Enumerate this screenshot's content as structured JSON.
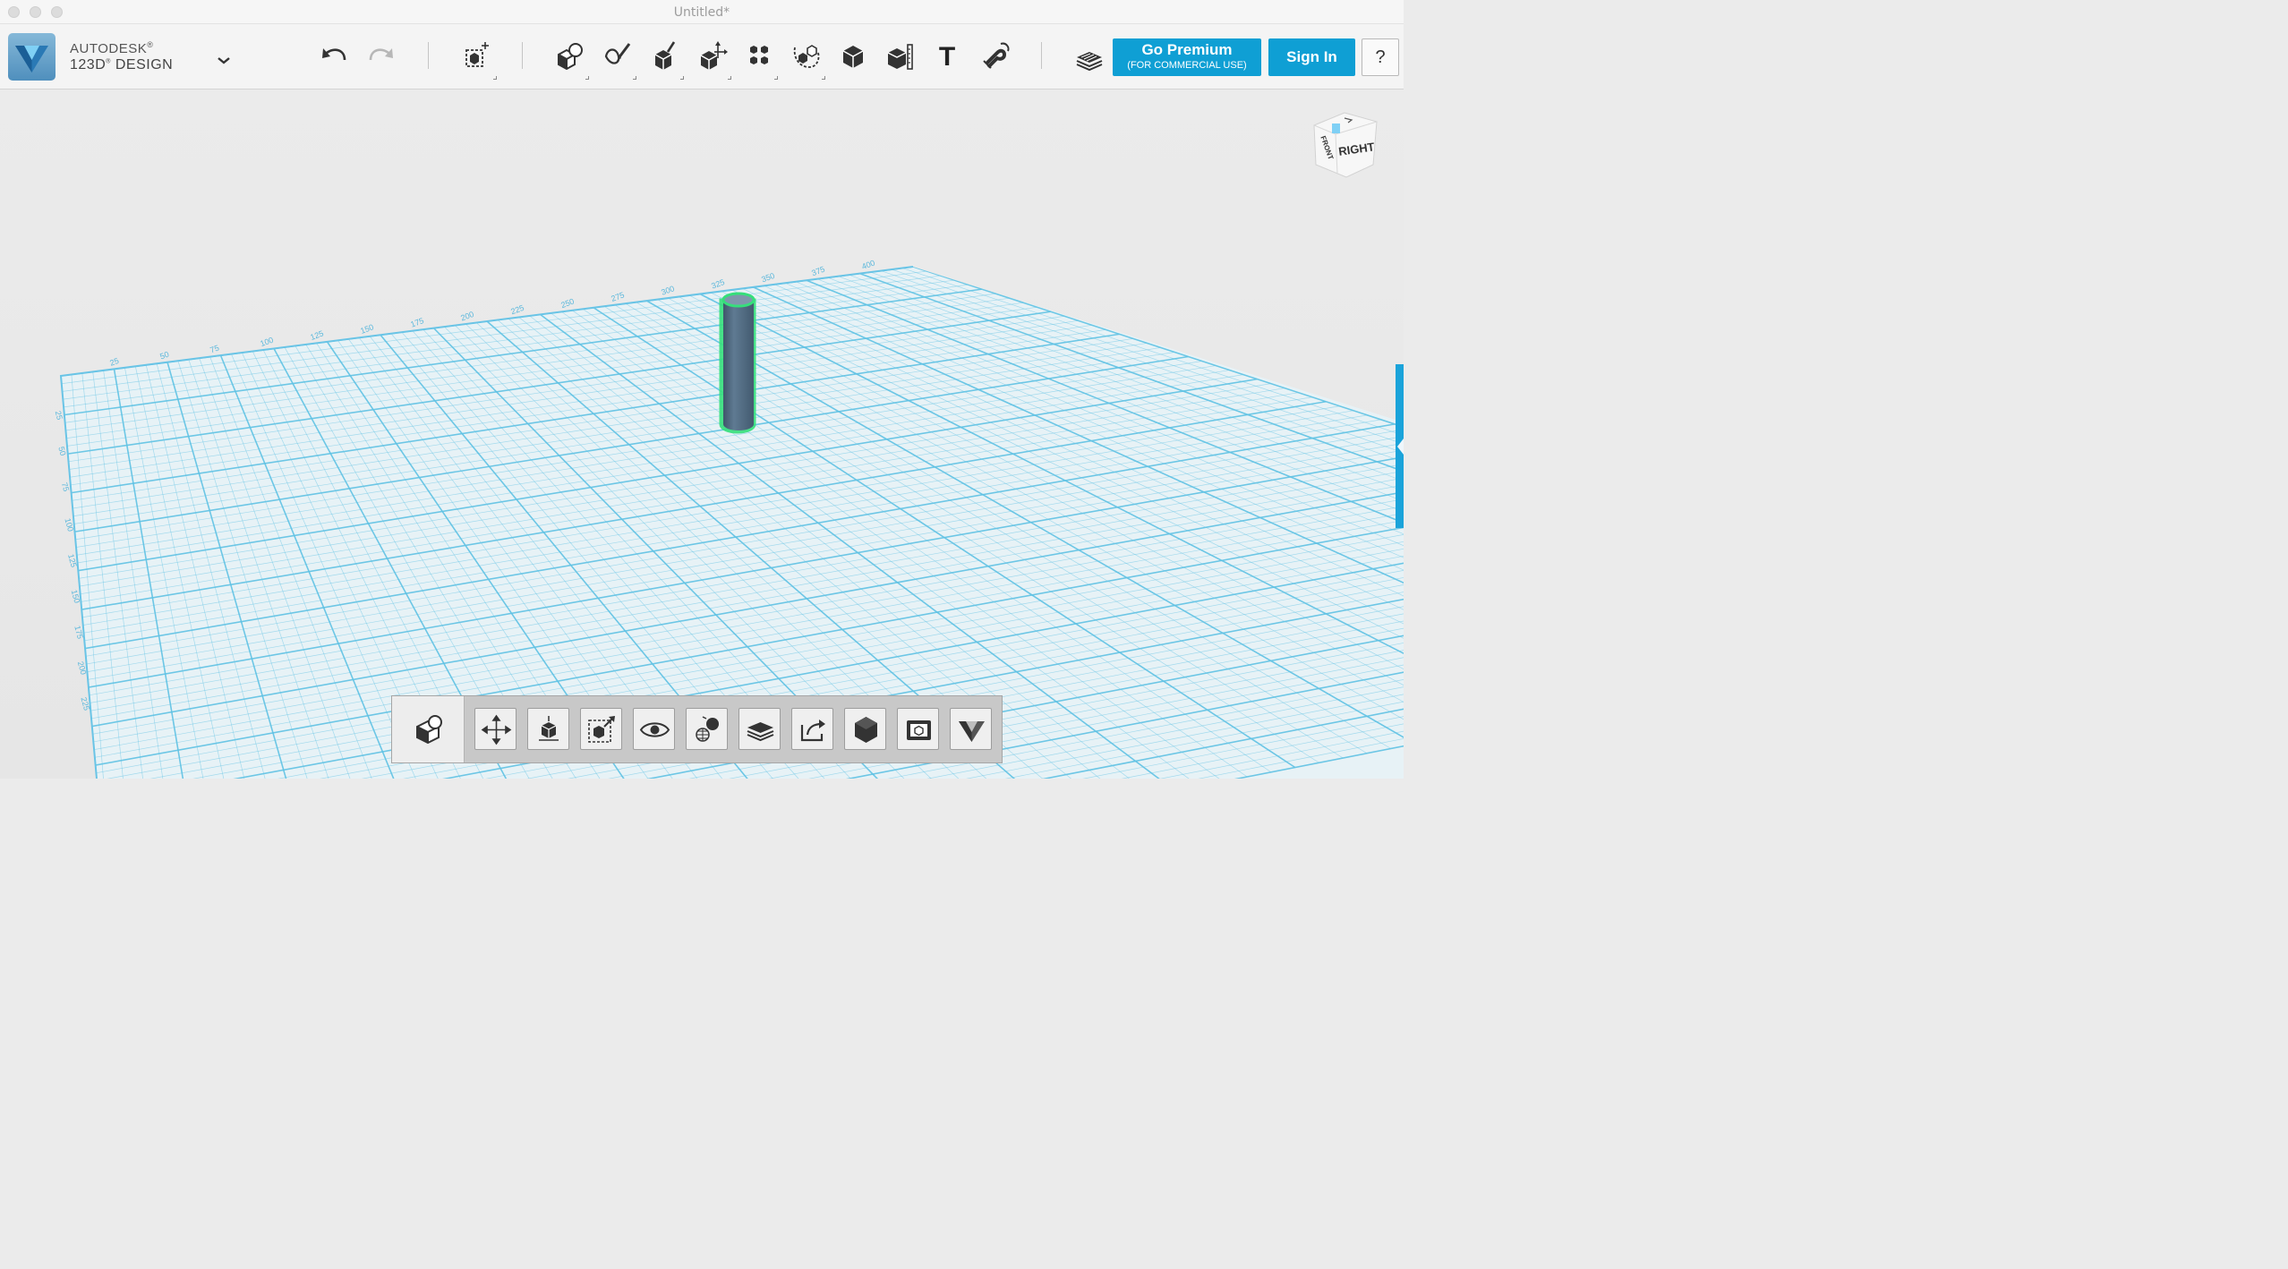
{
  "window": {
    "title": "Untitled*"
  },
  "brand": {
    "line1": "AUTODESK",
    "line1_mark": "®",
    "line2": "123D",
    "line2_mark": "®",
    "line2_rest": " DESIGN"
  },
  "toolbar": {
    "undo": "undo-icon",
    "redo": "redo-icon",
    "transform": "transform-icon",
    "tools": [
      "primitives-icon",
      "sketch-icon",
      "construct-icon",
      "modify-icon",
      "pattern-icon",
      "grouping-icon",
      "combine-icon",
      "measure-icon",
      "text-icon",
      "snap-icon"
    ],
    "text_tool_glyph": "T",
    "materials": "materials-icon"
  },
  "premium": {
    "label": "Go Premium",
    "sublabel": "(FOR COMMERCIAL USE)"
  },
  "signin": {
    "label": "Sign In"
  },
  "help": {
    "label": "?"
  },
  "viewcube": {
    "face_right": "RIGHT",
    "face_front": "FRONT"
  },
  "grid": {
    "top_ticks": [
      "25",
      "50",
      "75",
      "100",
      "125",
      "150",
      "175",
      "200",
      "225",
      "250",
      "275",
      "300",
      "325",
      "350",
      "375",
      "400"
    ],
    "left_ticks": [
      "25",
      "50",
      "75",
      "100",
      "125",
      "150",
      "175",
      "200",
      "225"
    ]
  },
  "scene": {
    "object": "cylinder",
    "selected": true
  },
  "colors": {
    "accent": "#0f9fd4",
    "grid_line": "#5fc2e4",
    "grid_fill": "#e6f3f8",
    "object": "#546f86",
    "selection": "#34e07a"
  },
  "dock": {
    "home": "view-home-icon",
    "buttons": [
      "pan-icon",
      "orbit-icon",
      "zoom-fit-icon",
      "visibility-icon",
      "materials-render-icon",
      "layers-icon",
      "export-icon",
      "solid-view-icon",
      "camera-icon",
      "logo-menu-icon"
    ]
  }
}
